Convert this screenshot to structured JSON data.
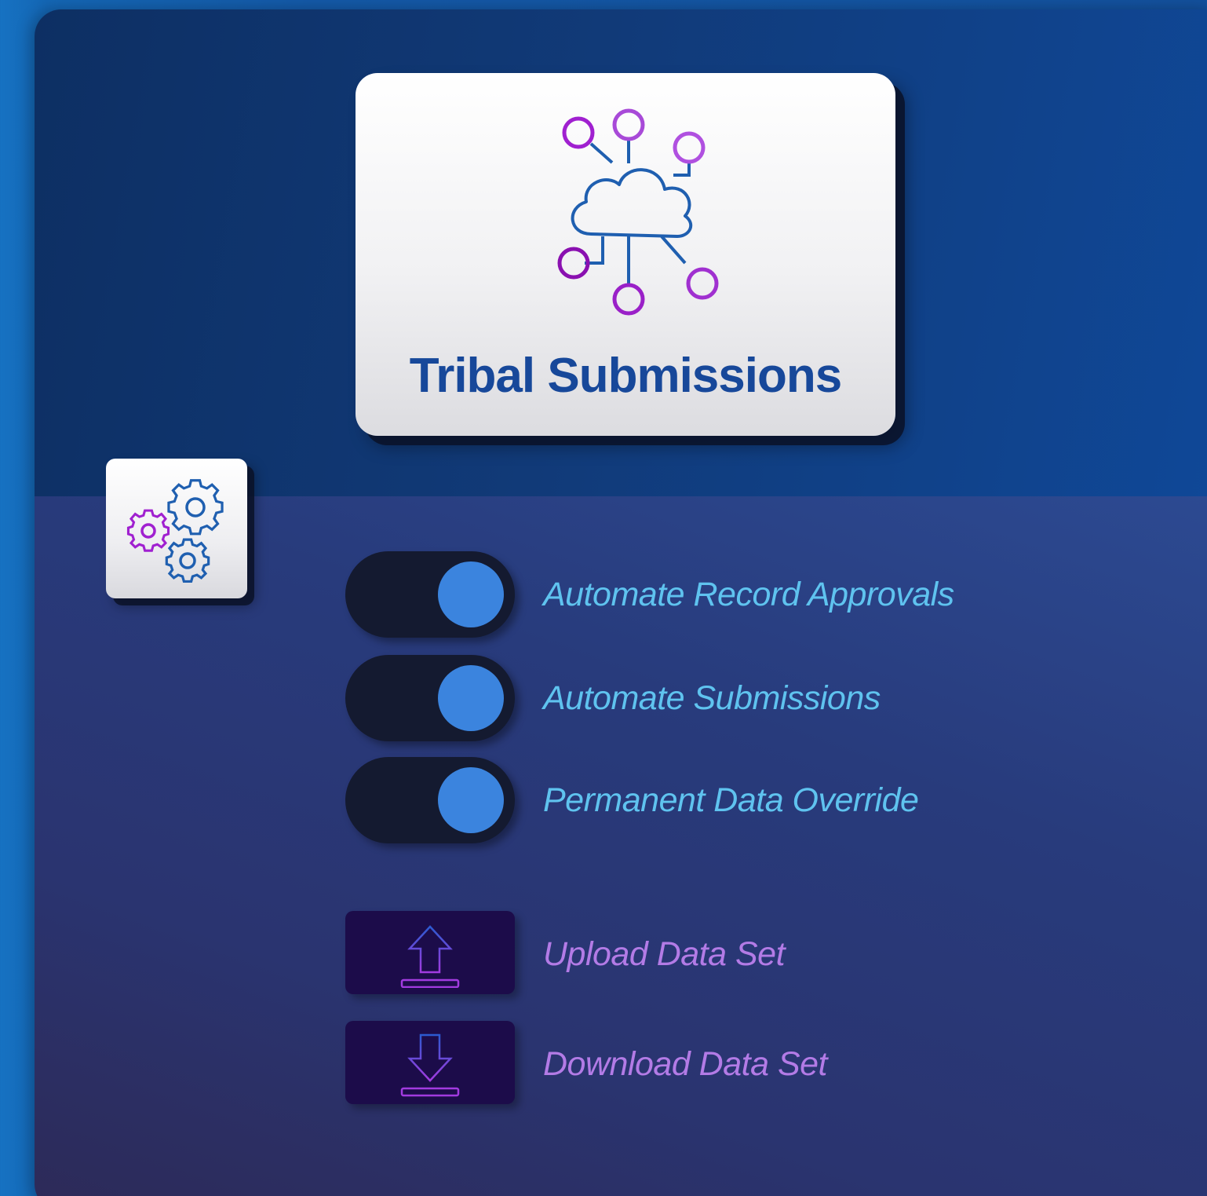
{
  "header": {
    "title": "Tribal Submissions",
    "icon": "cloud-network-icon"
  },
  "settings_button": {
    "icon": "gears-icon"
  },
  "toggles": [
    {
      "label": "Automate Record Approvals",
      "state": "on"
    },
    {
      "label": "Automate Submissions",
      "state": "on"
    },
    {
      "label": "Permanent Data Override",
      "state": "on"
    }
  ],
  "actions": [
    {
      "label": "Upload Data Set",
      "icon": "upload-icon"
    },
    {
      "label": "Download Data Set",
      "icon": "download-icon"
    }
  ],
  "colors": {
    "title": "#17489a",
    "toggle_label": "#5fc3ef",
    "action_label": "#b37be6",
    "toggle_track": "#141a30",
    "toggle_knob": "#3b84de",
    "action_button": "#1c0c4a",
    "icon_blue": "#1f5fb0",
    "icon_purple": "#a020d0"
  }
}
